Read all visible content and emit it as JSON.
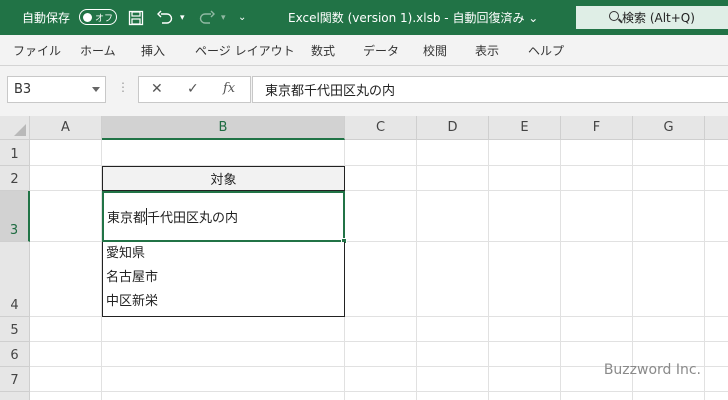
{
  "titlebar": {
    "autosave_label": "自動保存",
    "autosave_state": "オフ",
    "title": "Excel関数 (version 1).xlsb  -  自動回復済み  ⌄",
    "search_label": "検索 (Alt+Q)",
    "accent_color": "#217346"
  },
  "ribbon": {
    "tabs": [
      "ファイル",
      "ホーム",
      "挿入",
      "ページ レイアウト",
      "数式",
      "データ",
      "校閲",
      "表示",
      "ヘルプ"
    ]
  },
  "formula_bar": {
    "name_box": "B3",
    "cancel_icon": "✕",
    "enter_icon": "✓",
    "fx_label": "fx",
    "content": "東京都千代田区丸の内"
  },
  "sheet": {
    "columns": [
      "A",
      "B",
      "C",
      "D",
      "E",
      "F",
      "G"
    ],
    "rows": [
      "1",
      "2",
      "3",
      "4",
      "5",
      "6",
      "7"
    ],
    "b2": "対象",
    "b3_before": "東京都",
    "b3_after": "千代田区丸の内",
    "b4_lines": [
      "愛知県",
      "名古屋市",
      "中区新栄"
    ]
  },
  "watermark": "Buzzword Inc."
}
